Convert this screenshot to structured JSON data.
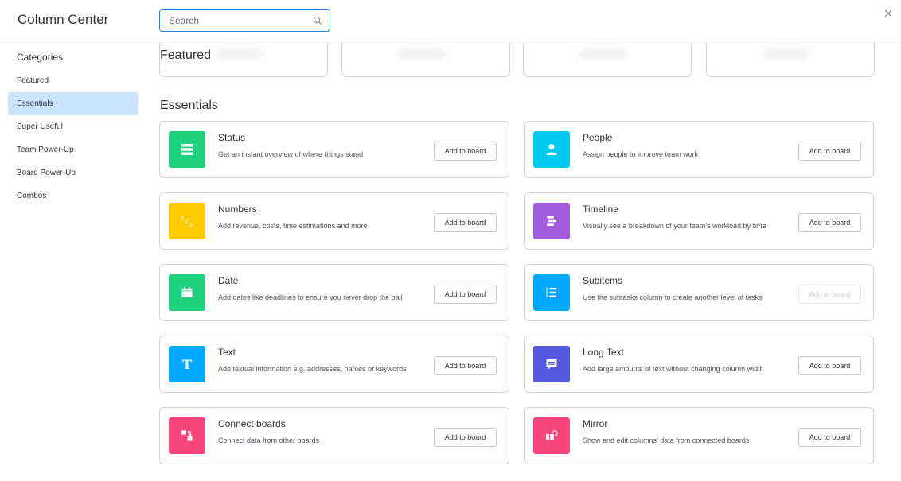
{
  "header": {
    "title": "Column Center",
    "search_placeholder": "Search",
    "search_value": ""
  },
  "sidebar": {
    "heading": "Categories",
    "items": [
      {
        "label": "Featured",
        "active": false
      },
      {
        "label": "Essentials",
        "active": true
      },
      {
        "label": "Super Useful",
        "active": false
      },
      {
        "label": "Team Power-Up",
        "active": false
      },
      {
        "label": "Board Power-Up",
        "active": false
      },
      {
        "label": "Combos",
        "active": false
      }
    ]
  },
  "main": {
    "featured_title": "Featured",
    "essentials_title": "Essentials",
    "columns": [
      {
        "name": "Status",
        "description": "Get an instant overview of where things stand",
        "icon": "status-icon",
        "color": "#1fd07d",
        "button": "Add to board",
        "button_enabled": true
      },
      {
        "name": "People",
        "description": "Assign people to improve team work",
        "icon": "person-icon",
        "color": "#00c9f0",
        "button": "Add to board",
        "button_enabled": true
      },
      {
        "name": "Numbers",
        "description": "Add revenue, costs, time estimations and more",
        "icon": "numbers-icon",
        "color": "#ffcb00",
        "button": "Add to board",
        "button_enabled": true
      },
      {
        "name": "Timeline",
        "description": "Visually see a breakdown of your team's workload by time",
        "icon": "timeline-icon",
        "color": "#a25ddc",
        "button": "Add to board",
        "button_enabled": true
      },
      {
        "name": "Date",
        "description": "Add dates like deadlines to ensure you never drop the ball",
        "icon": "calendar-icon",
        "color": "#1fd07d",
        "button": "Add to board",
        "button_enabled": true
      },
      {
        "name": "Subitems",
        "description": "Use the subtasks column to create another level of tasks",
        "icon": "subitems-icon",
        "color": "#00a9ff",
        "button": "Add to board",
        "button_enabled": false
      },
      {
        "name": "Text",
        "description": "Add textual information e.g. addresses, names or keywords",
        "icon": "text-icon",
        "color": "#00a9ff",
        "button": "Add to board",
        "button_enabled": true
      },
      {
        "name": "Long Text",
        "description": "Add large amounts of text without changing column width",
        "icon": "chat-icon",
        "color": "#5559df",
        "button": "Add to board",
        "button_enabled": true
      },
      {
        "name": "Connect boards",
        "description": "Connect data from other boards",
        "icon": "connect-boards-icon",
        "color": "#f6467c",
        "button": "Add to board",
        "button_enabled": true
      },
      {
        "name": "Mirror",
        "description": "Show and edit columns' data from connected boards",
        "icon": "mirror-icon",
        "color": "#f6467c",
        "button": "Add to board",
        "button_enabled": true
      }
    ]
  }
}
